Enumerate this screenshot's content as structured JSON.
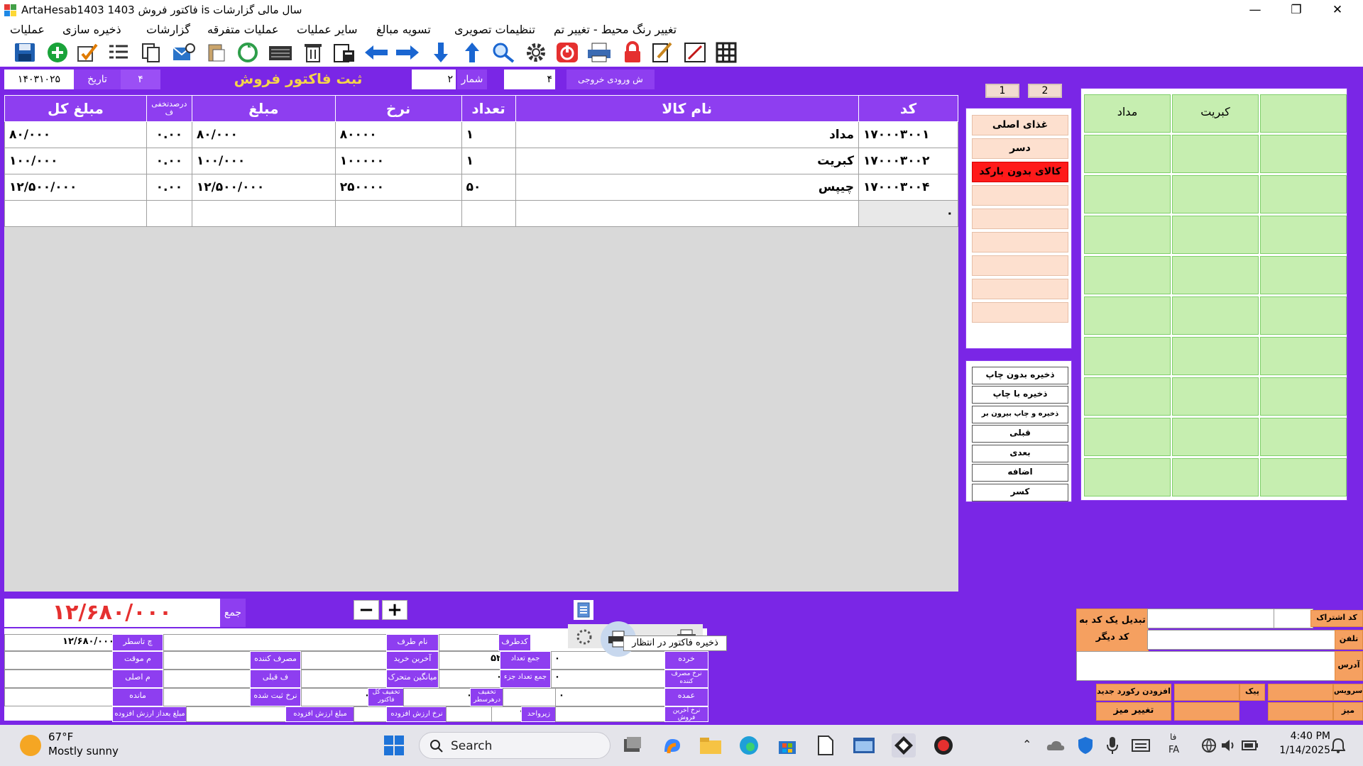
{
  "window": {
    "title": "ArtaHesab1403   فاکتور فروش   1403 is سال مالی گزارشات",
    "minimize": "—",
    "restore": "❐",
    "close": "✕"
  },
  "menu": [
    "عملیات",
    "ذخیره سازی",
    "گزارشات",
    "عملیات متفرقه",
    "سایر عملیات",
    "تسویه مبالغ",
    "تنظیمات تصویری",
    "تغییر رنگ محیط - تغییر تم"
  ],
  "header": {
    "date_value": "۱۴۰۳۱۰۲۵",
    "date_label": "تاریخ",
    "field_4": "۴",
    "form_title": "ثبت فاکتور فروش",
    "number_value": "۲",
    "number_label": "شمار",
    "output_value": "۴",
    "output_label": "ش ورودی خروجی"
  },
  "page_buttons": [
    "1",
    "2"
  ],
  "table": {
    "columns": [
      "مبلغ کل",
      "درصدتخفی ف",
      "مبلغ",
      "نرخ",
      "تعداد",
      "نام کالا",
      "کد"
    ],
    "rows": [
      {
        "total": "۸۰/۰۰۰",
        "discount": "۰.۰۰",
        "amount": "۸۰/۰۰۰",
        "rate": "۸۰۰۰۰",
        "qty": "۱",
        "name": "مداد",
        "code": "۱۷۰۰۰۳۰۰۱"
      },
      {
        "total": "۱۰۰/۰۰۰",
        "discount": "۰.۰۰",
        "amount": "۱۰۰/۰۰۰",
        "rate": "۱۰۰۰۰۰",
        "qty": "۱",
        "name": "کبریت",
        "code": "۱۷۰۰۰۳۰۰۲"
      },
      {
        "total": "۱۲/۵۰۰/۰۰۰",
        "discount": "۰.۰۰",
        "amount": "۱۲/۵۰۰/۰۰۰",
        "rate": "۲۵۰۰۰۰",
        "qty": "۵۰",
        "name": "چیپس",
        "code": "۱۷۰۰۰۳۰۰۴"
      }
    ],
    "new_row_code": "۰"
  },
  "categories": [
    "غذای اصلی",
    "دسر",
    "کالای بدون بارکد",
    "",
    "",
    "",
    "",
    "",
    ""
  ],
  "actions": [
    "ذخیره بدون چاپ",
    "ذخیره با چاپ",
    "ذخیره و چاپ بیرون بر",
    "قبلی",
    "بعدی",
    "اضافه",
    "کسر"
  ],
  "products": [
    "مداد",
    "کبریت",
    "",
    "",
    "",
    "",
    "",
    "",
    "",
    "",
    "",
    "",
    "",
    "",
    "",
    "",
    "",
    "",
    "",
    "",
    "",
    "",
    "",
    "",
    "",
    "",
    "",
    "",
    "",
    "",
    "",
    "",
    "",
    "",
    "",
    "",
    "",
    "",
    "",
    ""
  ],
  "totals": {
    "sum_value": "۱۲/۶۸۰/۰۰۰",
    "sum_label": "جمع",
    "minus": "−",
    "plus": "+"
  },
  "bottom_fields": {
    "final_value": "۱۲/۶۸۰/۰۰۰",
    "final_label": "چ تاسطر",
    "temp_label": "م موقت",
    "original_label": "م اصلی",
    "remain_label": "مانده",
    "remain_value": "۰",
    "vat_label": "مبلغ بعداز ارزش افزوده",
    "consumer_label": "مصرف کننده",
    "previous_label": "ف قبلی",
    "registered_label": "نرخ ثبت شده",
    "registered_value": "۰",
    "vat_amount_label": "مبلغ ارزش افزوده",
    "invoice_discount_label": "تخفیف کل فاکتور",
    "invoice_discount_value": "۰",
    "party_label": "نام طرف",
    "last_purchase_label": "آخرین خرید",
    "last_purchase_value": "۵۲",
    "avg_label": "میانگین متحرک",
    "avg_value": "۰",
    "vat_rate_label": "نرخ ارزش افزوده",
    "row_discount_label": "تخفیف درهرسطر",
    "party_code_label": "کدطرف",
    "party_code_value": "۰",
    "qty_sum_label": "جمع تعداد",
    "qty_part_sum_label": "جمع تعداد جزء",
    "unit_label": "زیرواحد",
    "unit_value": "۱",
    "retail_label": "خرده",
    "retail_value": "۰",
    "consumer_rate_label": "نرخ مصرف کننده",
    "consumer_rate_value": "۰",
    "wholesale_label": "عمده",
    "wholesale_value": "۰",
    "last_rate_label": "نرخ آخرین فروش",
    "tooltip": "ذخیره فاکتور در انتظار"
  },
  "right_panel": {
    "convert_label": "تبدیل یک کد به کد دیگر",
    "subscription_label": "کد اشتراک",
    "phone_label": "تلفن",
    "address_label": "آدرس",
    "new_record_label": "افزودن رکورد جدید",
    "change_table_label": "تغییر میز",
    "delivery_label": "پیک",
    "service_label": "سرویس",
    "table_label": "میز"
  },
  "taskbar": {
    "temp": "67°F",
    "weather": "Mostly sunny",
    "search": "Search",
    "lang": "FA",
    "lang_top": "فا",
    "time": "4:40 PM",
    "date": "1/14/2025"
  }
}
